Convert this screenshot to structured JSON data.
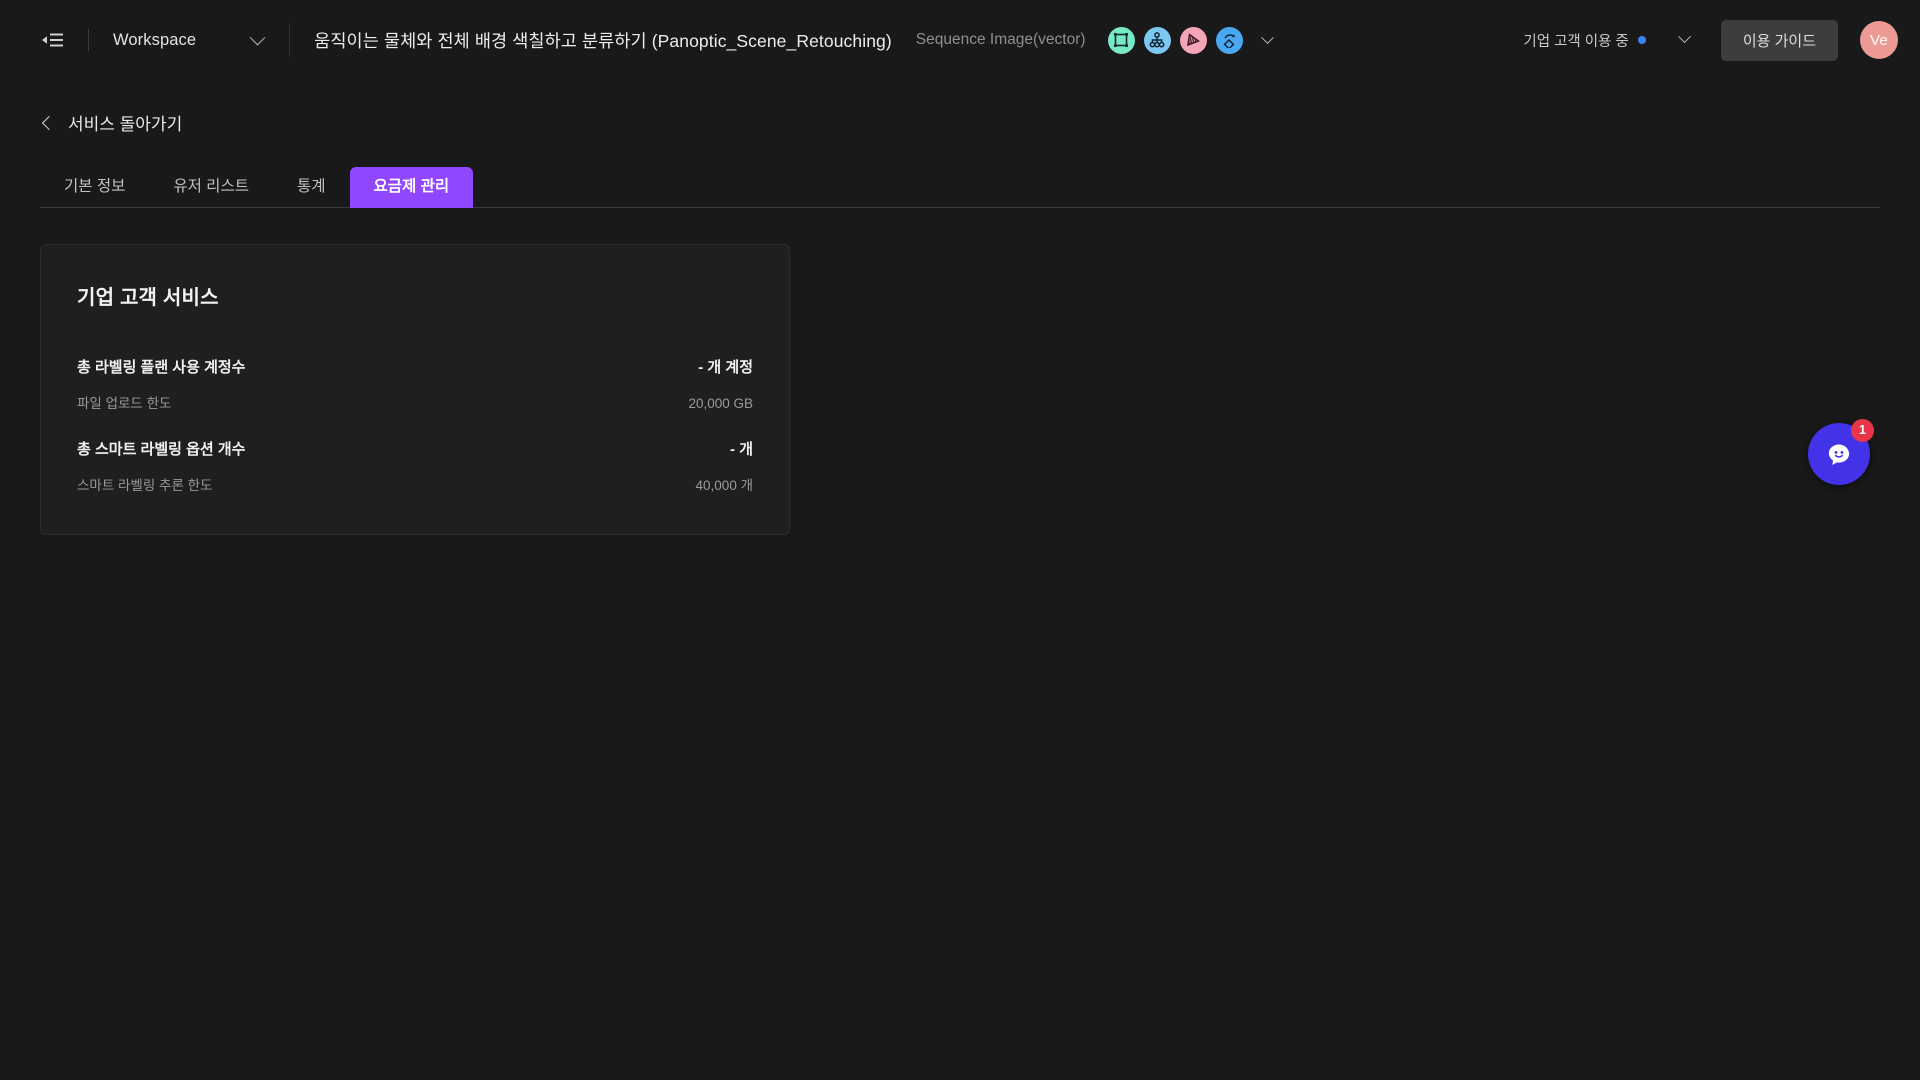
{
  "topbar": {
    "collapse_icon": "collapse-sidebar-icon",
    "workspace_label": "Workspace",
    "workspace_chevron_icon": "chevron-down-icon",
    "project_title": "움직이는 물체와 전체 배경 색칠하고 분류하기 (Panoptic_Scene_Retouching)",
    "project_type": "Sequence Image(vector)",
    "tool_icons": [
      {
        "name": "bounding-box-icon",
        "color": "#79e8c6"
      },
      {
        "name": "hierarchy-tree-icon",
        "color": "#7cc8f0"
      },
      {
        "name": "polygon-mesh-icon",
        "color": "#f4a6b8"
      },
      {
        "name": "rotate-cuboid-icon",
        "color": "#4aa8f0"
      }
    ],
    "tool_more_icon": "chevron-down-icon",
    "plan_status": "기업 고객 이용 중",
    "plan_status_dot_color": "#3b82f6",
    "plan_chevron_icon": "chevron-down-icon",
    "guide_button": "이용 가이드",
    "avatar_initials": "Ve",
    "avatar_color": "#ed9a94"
  },
  "content": {
    "back_link": "서비스 돌아가기",
    "back_icon": "chevron-left-icon",
    "tabs": [
      {
        "label": "기본 정보",
        "active": false
      },
      {
        "label": "유저 리스트",
        "active": false
      },
      {
        "label": "통계",
        "active": false
      },
      {
        "label": "요금제 관리",
        "active": true
      }
    ],
    "active_tab_color": "#9146ff"
  },
  "card": {
    "title": "기업 고객 서비스",
    "rows": [
      {
        "main_label": "총 라벨링 플랜 사용 계정수",
        "main_value": "- 개 계정",
        "sub_label": "파일 업로드 한도",
        "sub_value": "20,000 GB"
      },
      {
        "main_label": "총 스마트 라벨링 옵션 개수",
        "main_value": "- 개",
        "sub_label": "스마트 라벨링 추론 한도",
        "sub_value": "40,000 개"
      }
    ]
  },
  "chat": {
    "icon": "chat-bubble-icon",
    "badge_count": "1",
    "badge_color": "#e8354a",
    "button_color": "#4333e8"
  }
}
